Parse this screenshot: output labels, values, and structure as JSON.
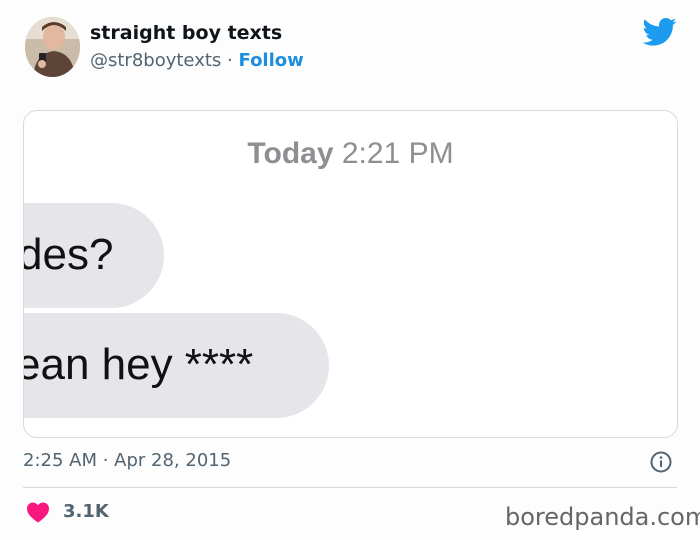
{
  "author": {
    "display_name": "straight boy texts",
    "handle": "@str8boytexts",
    "separator": "·",
    "follow_label": "Follow"
  },
  "icons": {
    "platform": "twitter-bird-icon",
    "info": "info-icon",
    "like": "heart-icon"
  },
  "media": {
    "header_day": "Today",
    "header_time": "2:21 PM",
    "bubbles": [
      {
        "text": "des?"
      },
      {
        "text": "ean hey ****"
      }
    ]
  },
  "footer": {
    "timestamp": "2:25 AM · Apr 28, 2015",
    "like_count": "3.1K",
    "watermark": "boredpanda.com"
  },
  "colors": {
    "accent": "#1d9bf0",
    "like": "#f91880",
    "bubble": "#e5e5ea"
  }
}
